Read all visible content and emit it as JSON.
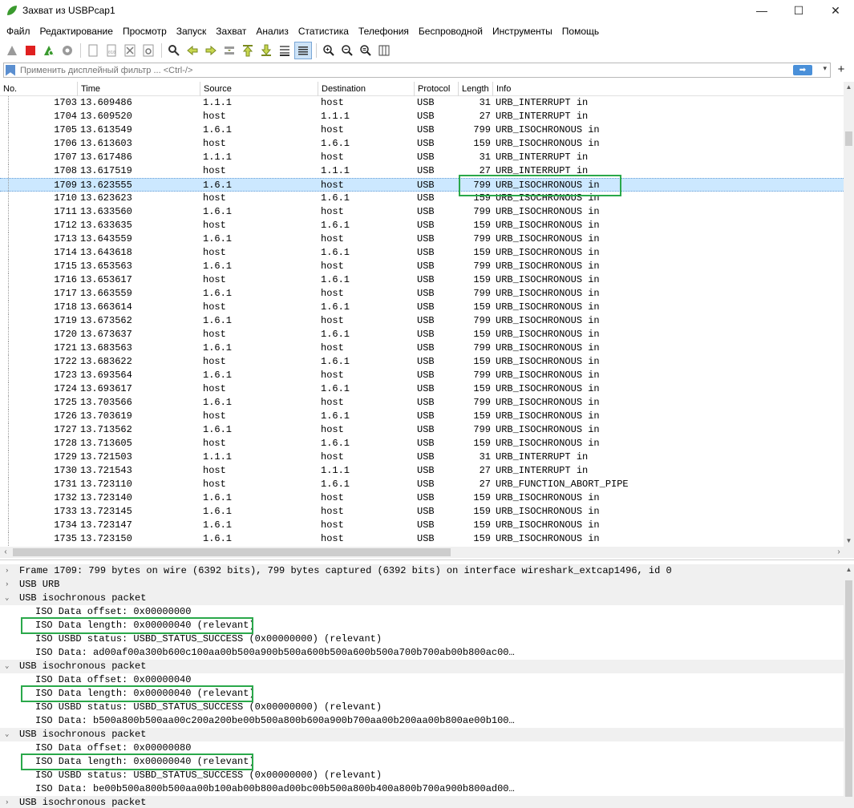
{
  "window": {
    "title": "Захват из USBPcap1",
    "minimize": "—",
    "maximize": "☐",
    "close": "✕"
  },
  "menu": [
    "Файл",
    "Редактирование",
    "Просмотр",
    "Запуск",
    "Захват",
    "Анализ",
    "Статистика",
    "Телефония",
    "Беспроводной",
    "Инструменты",
    "Помощь"
  ],
  "filter": {
    "placeholder": "Применить дисплейный фильтр ... <Ctrl-/>",
    "apply_icon": "➡",
    "dropdown_icon": "▾",
    "add_label": "+"
  },
  "columns": [
    "No.",
    "Time",
    "Source",
    "Destination",
    "Protocol",
    "Length",
    "Info"
  ],
  "packets": [
    [
      "1703",
      "13.609486",
      "1.1.1",
      "host",
      "USB",
      "31",
      "URB_INTERRUPT in"
    ],
    [
      "1704",
      "13.609520",
      "host",
      "1.1.1",
      "USB",
      "27",
      "URB_INTERRUPT in"
    ],
    [
      "1705",
      "13.613549",
      "1.6.1",
      "host",
      "USB",
      "799",
      "URB_ISOCHRONOUS in"
    ],
    [
      "1706",
      "13.613603",
      "host",
      "1.6.1",
      "USB",
      "159",
      "URB_ISOCHRONOUS in"
    ],
    [
      "1707",
      "13.617486",
      "1.1.1",
      "host",
      "USB",
      "31",
      "URB_INTERRUPT in"
    ],
    [
      "1708",
      "13.617519",
      "host",
      "1.1.1",
      "USB",
      "27",
      "URB_INTERRUPT in"
    ],
    [
      "1709",
      "13.623555",
      "1.6.1",
      "host",
      "USB",
      "799",
      "URB_ISOCHRONOUS in"
    ],
    [
      "1710",
      "13.623623",
      "host",
      "1.6.1",
      "USB",
      "159",
      "URB_ISOCHRONOUS in"
    ],
    [
      "1711",
      "13.633560",
      "1.6.1",
      "host",
      "USB",
      "799",
      "URB_ISOCHRONOUS in"
    ],
    [
      "1712",
      "13.633635",
      "host",
      "1.6.1",
      "USB",
      "159",
      "URB_ISOCHRONOUS in"
    ],
    [
      "1713",
      "13.643559",
      "1.6.1",
      "host",
      "USB",
      "799",
      "URB_ISOCHRONOUS in"
    ],
    [
      "1714",
      "13.643618",
      "host",
      "1.6.1",
      "USB",
      "159",
      "URB_ISOCHRONOUS in"
    ],
    [
      "1715",
      "13.653563",
      "1.6.1",
      "host",
      "USB",
      "799",
      "URB_ISOCHRONOUS in"
    ],
    [
      "1716",
      "13.653617",
      "host",
      "1.6.1",
      "USB",
      "159",
      "URB_ISOCHRONOUS in"
    ],
    [
      "1717",
      "13.663559",
      "1.6.1",
      "host",
      "USB",
      "799",
      "URB_ISOCHRONOUS in"
    ],
    [
      "1718",
      "13.663614",
      "host",
      "1.6.1",
      "USB",
      "159",
      "URB_ISOCHRONOUS in"
    ],
    [
      "1719",
      "13.673562",
      "1.6.1",
      "host",
      "USB",
      "799",
      "URB_ISOCHRONOUS in"
    ],
    [
      "1720",
      "13.673637",
      "host",
      "1.6.1",
      "USB",
      "159",
      "URB_ISOCHRONOUS in"
    ],
    [
      "1721",
      "13.683563",
      "1.6.1",
      "host",
      "USB",
      "799",
      "URB_ISOCHRONOUS in"
    ],
    [
      "1722",
      "13.683622",
      "host",
      "1.6.1",
      "USB",
      "159",
      "URB_ISOCHRONOUS in"
    ],
    [
      "1723",
      "13.693564",
      "1.6.1",
      "host",
      "USB",
      "799",
      "URB_ISOCHRONOUS in"
    ],
    [
      "1724",
      "13.693617",
      "host",
      "1.6.1",
      "USB",
      "159",
      "URB_ISOCHRONOUS in"
    ],
    [
      "1725",
      "13.703566",
      "1.6.1",
      "host",
      "USB",
      "799",
      "URB_ISOCHRONOUS in"
    ],
    [
      "1726",
      "13.703619",
      "host",
      "1.6.1",
      "USB",
      "159",
      "URB_ISOCHRONOUS in"
    ],
    [
      "1727",
      "13.713562",
      "1.6.1",
      "host",
      "USB",
      "799",
      "URB_ISOCHRONOUS in"
    ],
    [
      "1728",
      "13.713605",
      "host",
      "1.6.1",
      "USB",
      "159",
      "URB_ISOCHRONOUS in"
    ],
    [
      "1729",
      "13.721503",
      "1.1.1",
      "host",
      "USB",
      "31",
      "URB_INTERRUPT in"
    ],
    [
      "1730",
      "13.721543",
      "host",
      "1.1.1",
      "USB",
      "27",
      "URB_INTERRUPT in"
    ],
    [
      "1731",
      "13.723110",
      "host",
      "1.6.1",
      "USB",
      "27",
      "URB_FUNCTION_ABORT_PIPE"
    ],
    [
      "1732",
      "13.723140",
      "1.6.1",
      "host",
      "USB",
      "159",
      "URB_ISOCHRONOUS in"
    ],
    [
      "1733",
      "13.723145",
      "1.6.1",
      "host",
      "USB",
      "159",
      "URB_ISOCHRONOUS in"
    ],
    [
      "1734",
      "13.723147",
      "1.6.1",
      "host",
      "USB",
      "159",
      "URB_ISOCHRONOUS in"
    ],
    [
      "1735",
      "13.723150",
      "1.6.1",
      "host",
      "USB",
      "159",
      "URB_ISOCHRONOUS in"
    ]
  ],
  "selected_packet": "1709",
  "details": [
    {
      "level": 0,
      "expander": ">",
      "text": "Frame 1709: 799 bytes on wire (6392 bits), 799 bytes captured (6392 bits) on interface wireshark_extcap1496, id 0"
    },
    {
      "level": 0,
      "expander": ">",
      "text": "USB URB"
    },
    {
      "level": 0,
      "expander": "v",
      "text": "USB isochronous packet"
    },
    {
      "level": 1,
      "expander": "",
      "text": "ISO Data offset: 0x00000000"
    },
    {
      "level": 1,
      "expander": "",
      "text": "ISO Data length: 0x00000040 (relevant)",
      "highlight": true
    },
    {
      "level": 1,
      "expander": "",
      "text": "ISO USBD status: USBD_STATUS_SUCCESS (0x00000000) (relevant)"
    },
    {
      "level": 1,
      "expander": "",
      "text": "ISO Data: ad00af00a300b600c100aa00b500a900b500a600b500a600b500a700b700ab00b800ac00…"
    },
    {
      "level": 0,
      "expander": "v",
      "text": "USB isochronous packet"
    },
    {
      "level": 1,
      "expander": "",
      "text": "ISO Data offset: 0x00000040"
    },
    {
      "level": 1,
      "expander": "",
      "text": "ISO Data length: 0x00000040 (relevant)",
      "highlight": true
    },
    {
      "level": 1,
      "expander": "",
      "text": "ISO USBD status: USBD_STATUS_SUCCESS (0x00000000) (relevant)"
    },
    {
      "level": 1,
      "expander": "",
      "text": "ISO Data: b500a800b500aa00c200a200be00b500a800b600a900b700aa00b200aa00b800ae00b100…"
    },
    {
      "level": 0,
      "expander": "v",
      "text": "USB isochronous packet"
    },
    {
      "level": 1,
      "expander": "",
      "text": "ISO Data offset: 0x00000080"
    },
    {
      "level": 1,
      "expander": "",
      "text": "ISO Data length: 0x00000040 (relevant)",
      "highlight": true
    },
    {
      "level": 1,
      "expander": "",
      "text": "ISO USBD status: USBD_STATUS_SUCCESS (0x00000000) (relevant)"
    },
    {
      "level": 1,
      "expander": "",
      "text": "ISO Data: be00b500a800b500aa00b100ab00b800ad00bc00b500a800b400a800b700a900b800ad00…"
    },
    {
      "level": 0,
      "expander": ">",
      "text": "USB isochronous packet"
    }
  ],
  "toolbar_icons": [
    "shark-fin-start-icon",
    "stop-capture-icon",
    "restart-capture-icon",
    "capture-options-icon",
    "open-file-icon",
    "save-file-icon",
    "close-file-icon",
    "reload-file-icon",
    "find-packet-icon",
    "go-back-icon",
    "go-forward-icon",
    "go-to-packet-icon",
    "go-first-packet-icon",
    "go-last-packet-icon",
    "auto-scroll-icon",
    "colorize-icon",
    "zoom-in-icon",
    "zoom-out-icon",
    "zoom-normal-icon",
    "resize-columns-icon"
  ],
  "colors": {
    "selection": "#cce8ff",
    "highlight_box": "#2aa84a",
    "wireshark_green": "#3a9a2e"
  }
}
